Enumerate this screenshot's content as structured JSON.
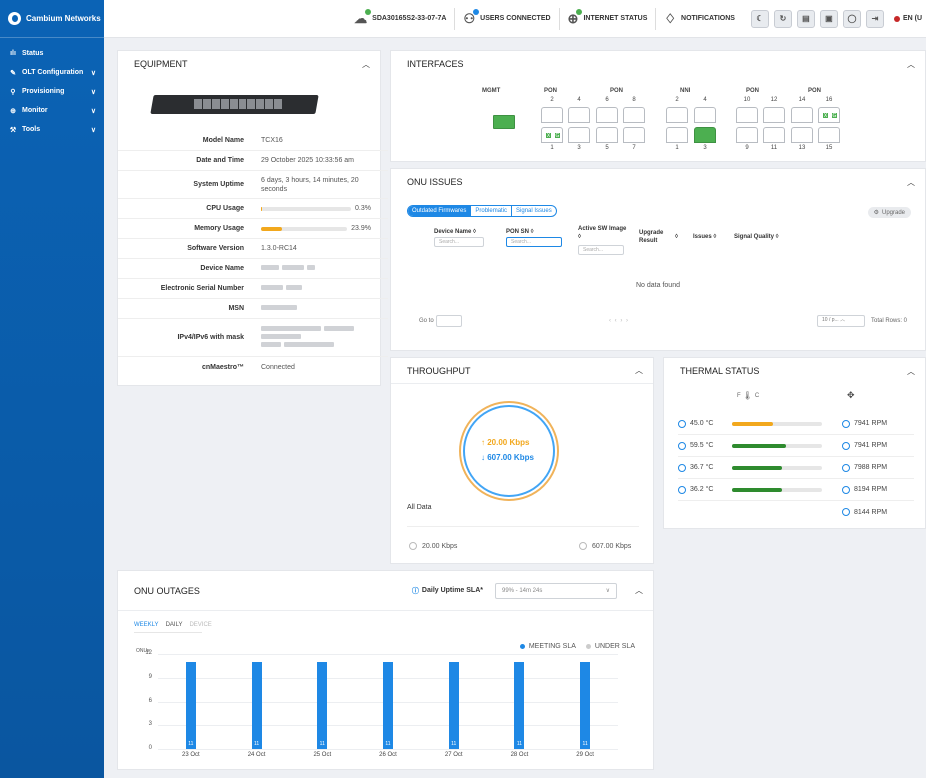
{
  "brand": "Cambium Networks",
  "nav": [
    {
      "icon": "ılı",
      "label": "Status",
      "chevron": ""
    },
    {
      "icon": "✎",
      "label": "OLT Configuration",
      "chevron": "∨"
    },
    {
      "icon": "⚲",
      "label": "Provisioning",
      "chevron": "∨"
    },
    {
      "icon": "⊕",
      "label": "Monitor",
      "chevron": "∨"
    },
    {
      "icon": "⚒",
      "label": "Tools",
      "chevron": "∨"
    }
  ],
  "topbar": {
    "device_id": "SDA30165S2-33-07-7A",
    "users_connected": "USERS CONNECTED",
    "internet_status": "INTERNET STATUS",
    "notifications": "NOTIFICATIONS",
    "language": "EN (U",
    "status_colors": {
      "ok": "#4caf50",
      "users": "#1e88e5"
    }
  },
  "equipment": {
    "title": "EQUIPMENT",
    "fields": [
      {
        "label": "Model Name",
        "value": "TCX16"
      },
      {
        "label": "Date and Time",
        "value": "29 October 2025 10:33:56 am"
      },
      {
        "label": "System Uptime",
        "value": "6 days, 3 hours, 14 minutes, 20 seconds"
      },
      {
        "label": "CPU Usage",
        "value": "0.3%",
        "percent": 0.3
      },
      {
        "label": "Memory Usage",
        "value": "23.9%",
        "percent": 23.9
      },
      {
        "label": "Software Version",
        "value": "1.3.0-RC14"
      },
      {
        "label": "Device Name",
        "value": ""
      },
      {
        "label": "Electronic Serial Number",
        "value": ""
      },
      {
        "label": "MSN",
        "value": ""
      },
      {
        "label": "IPv4/IPv6 with mask",
        "value": ""
      },
      {
        "label": "cnMaestro™",
        "value": "Connected"
      }
    ]
  },
  "interfaces": {
    "title": "INTERFACES",
    "groups": [
      "MGMT",
      "PON",
      "PON",
      "NNI",
      "PON",
      "PON"
    ],
    "top_ports": [
      "2",
      "4",
      "6",
      "8",
      "2",
      "4",
      "10",
      "12",
      "14",
      "16"
    ],
    "bottom_ports": [
      "1",
      "3",
      "5",
      "7",
      "1",
      "3",
      "9",
      "11",
      "13",
      "15"
    ],
    "port_badges": [
      "X",
      "G"
    ],
    "active_color": "#4caf50"
  },
  "onu_issues": {
    "title": "ONU ISSUES",
    "tabs": [
      "Outdated Firmwares",
      "Problematic",
      "Signal Issues"
    ],
    "upgrade_label": "Upgrade",
    "columns": [
      "Device Name ◊",
      "PON SN ◊",
      "Active SW Image ◊",
      "Upgrade Result",
      "◊",
      "Issues ◊",
      "Signal Quality ◊"
    ],
    "search_placeholder": "Search...",
    "no_data": "No data found",
    "goto_label": "Go to",
    "pager": "‹   ‹   ›   ›",
    "page_size": "10 / p...",
    "total_rows": "Total Rows: 0"
  },
  "throughput": {
    "title": "THROUGHPUT",
    "up": "↑ 20.00 Kbps",
    "down": "↓ 607.00 Kbps",
    "all_data_label": "All Data",
    "total_up": "20.00 Kbps",
    "total_down": "607.00 Kbps",
    "up_color": "#f2a81d",
    "down_color": "#1e88e5"
  },
  "thermal": {
    "title": "THERMAL STATUS",
    "unit_toggle": "F",
    "unit_c": "C",
    "sensors": [
      {
        "temp": "45.0 °C",
        "level": 0.45,
        "color": "#f2a81d",
        "rpm": "7941 RPM"
      },
      {
        "temp": "59.5 °C",
        "level": 0.6,
        "color": "#2e8b2e",
        "rpm": "7941 RPM"
      },
      {
        "temp": "36.7 °C",
        "level": 0.55,
        "color": "#2e8b2e",
        "rpm": "7988 RPM"
      },
      {
        "temp": "36.2 °C",
        "level": 0.55,
        "color": "#2e8b2e",
        "rpm": "8194 RPM"
      },
      {
        "temp": "",
        "level": 0,
        "color": "",
        "rpm": "8144 RPM"
      }
    ]
  },
  "outages": {
    "title": "ONU OUTAGES",
    "sla_label": "Daily Uptime SLA*",
    "sla_value": "99% - 14m 24s",
    "tabs": [
      "WEEKLY",
      "DAILY",
      "DEVICE"
    ],
    "legend": [
      "MEETING SLA",
      "UNDER SLA"
    ],
    "y_unit": "ONUs"
  },
  "chart_data": {
    "type": "bar",
    "categories": [
      "23 Oct",
      "24 Oct",
      "25 Oct",
      "26 Oct",
      "27 Oct",
      "28 Oct",
      "29 Oct"
    ],
    "series": [
      {
        "name": "MEETING SLA",
        "values": [
          11,
          11,
          11,
          11,
          11,
          11,
          11
        ]
      }
    ],
    "ylabel": "ONUs",
    "ylim": [
      0,
      12
    ],
    "yticks": [
      0,
      3,
      6,
      9,
      12
    ],
    "legend": "top-right",
    "bar_color": "#1e88e5"
  }
}
